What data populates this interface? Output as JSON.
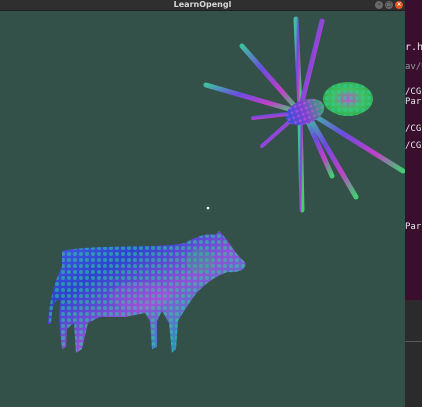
{
  "window": {
    "title": "LearnOpengl"
  },
  "controls": {
    "minimize": "–",
    "maximize": "□",
    "close": "×"
  },
  "background_terminal": {
    "lines": [
      "r.h",
      "av/D",
      "/CG-",
      "Pars",
      "/CG-",
      "/CG-",
      "Pars"
    ]
  },
  "scene": {
    "background_color": "#335049",
    "models": [
      "spider-model",
      "cow-model"
    ]
  }
}
